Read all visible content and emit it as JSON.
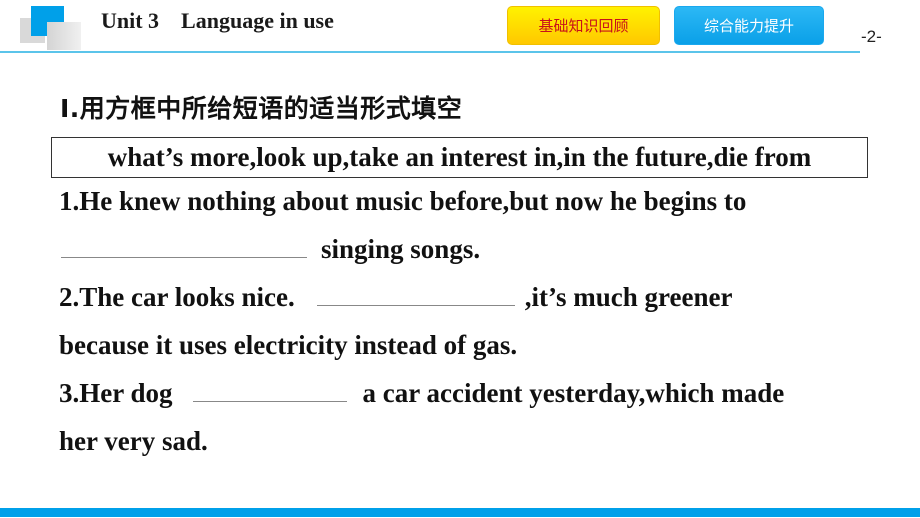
{
  "header": {
    "unit_title": "Unit 3    Language in use",
    "buttons": [
      {
        "label": "基础知识回顾",
        "color": "#ffd400"
      },
      {
        "label": "综合能力提升",
        "color": "#1aaef0"
      }
    ],
    "page_number": "-2-"
  },
  "section": {
    "title": "Ⅰ.用方框中所给短语的适当形式填空",
    "phrase_box": "what’s more,look up,take an interest in,in the future,die from"
  },
  "questions": [
    {
      "line1": "1.He knew nothing about music before,but now he begins to",
      "line2_after_blank": "singing songs."
    },
    {
      "line1_before_blank": "2.The car looks nice.",
      "line1_after_blank": ",it’s much greener",
      "line2": "because it uses electricity instead of gas."
    },
    {
      "line1_before_blank": "3.Her dog",
      "line1_after_blank": "a car accident yesterday,which made",
      "line2": "her very sad."
    }
  ],
  "colors": {
    "accent_blue": "#00a0e9",
    "header_line": "#5bc4ea"
  }
}
